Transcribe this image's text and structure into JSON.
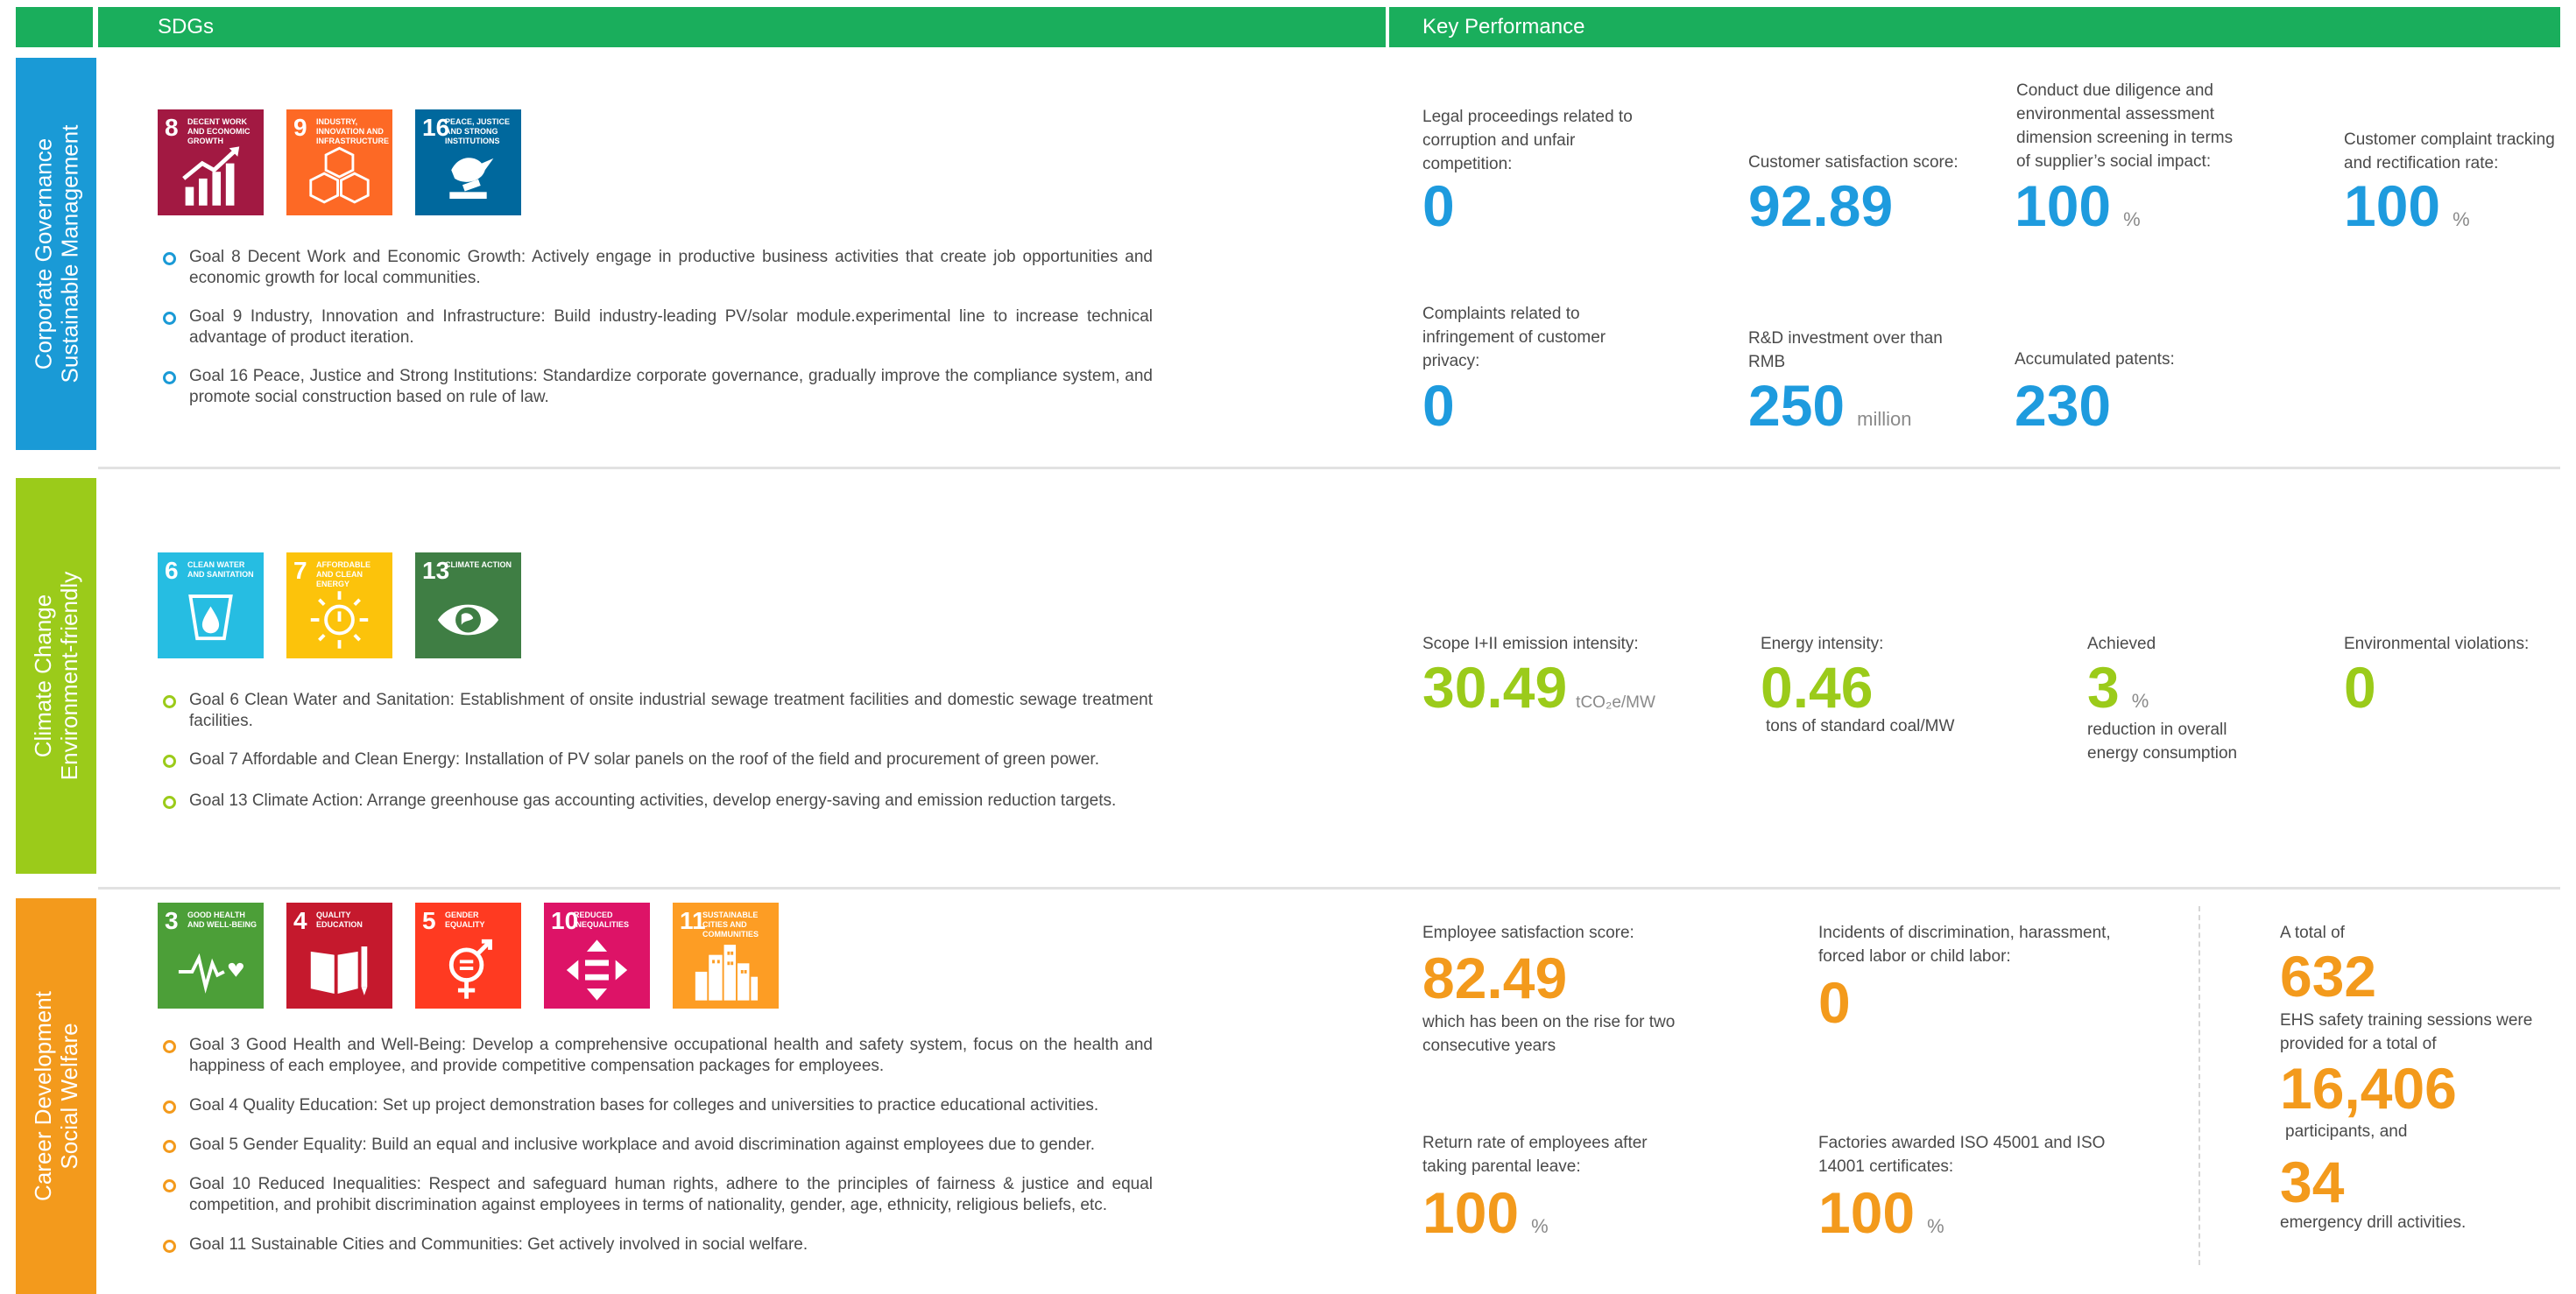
{
  "header": {
    "sdgs": "SDGs",
    "key_performance": "Key Performance"
  },
  "colors": {
    "green_header": "#1aae5c",
    "section1": "#1a9ad6",
    "section2": "#9bcb1a",
    "section3": "#f39a1c"
  },
  "sections": [
    {
      "title_lines": [
        "Corporate Governance",
        "Sustainable Management"
      ],
      "icons": [
        {
          "num": "8",
          "caption": "DECENT WORK AND ECONOMIC GROWTH",
          "color": "#a21942",
          "icon": "growth-chart-icon"
        },
        {
          "num": "9",
          "caption": "INDUSTRY, INNOVATION AND INFRASTRUCTURE",
          "color": "#fd6925",
          "icon": "cubes-icon"
        },
        {
          "num": "16",
          "caption": "PEACE, JUSTICE AND STRONG INSTITUTIONS",
          "color": "#00689d",
          "icon": "dove-gavel-icon"
        }
      ],
      "goals": [
        "Goal 8 Decent Work and Economic Growth: Actively engage in productive business activities that create job opportunities and economic growth for local communities.",
        "Goal 9 Industry, Innovation and Infrastructure: Build industry-leading PV/solar module.experimental line to increase technical advantage of product iteration.",
        "Goal 16 Peace, Justice and Strong Institutions: Standardize corporate governance, gradually improve the compliance system, and promote social construction based on rule of law."
      ],
      "metrics": [
        {
          "label": "Legal proceedings related to corruption and unfair competition:",
          "value": "0",
          "unit": ""
        },
        {
          "label": "Customer satisfaction score:",
          "value": "92.89",
          "unit": ""
        },
        {
          "label": "Conduct due diligence and environmental assessment dimension screening in terms of supplier’s social impact:",
          "value": "100",
          "unit": "%"
        },
        {
          "label": "Customer complaint tracking and rectification rate:",
          "value": "100",
          "unit": "%"
        },
        {
          "label": "Complaints related to infringement of customer privacy:",
          "value": "0",
          "unit": ""
        },
        {
          "label": "R&D investment over than RMB",
          "value": "250",
          "unit": "million"
        },
        {
          "label": "Accumulated patents:",
          "value": "230",
          "unit": ""
        }
      ]
    },
    {
      "title_lines": [
        "Climate Change",
        "Environment-friendly"
      ],
      "icons": [
        {
          "num": "6",
          "caption": "CLEAN WATER AND SANITATION",
          "color": "#26bde2",
          "icon": "water-drop-icon"
        },
        {
          "num": "7",
          "caption": "AFFORDABLE AND CLEAN ENERGY",
          "color": "#fcc30b",
          "icon": "sun-power-icon"
        },
        {
          "num": "13",
          "caption": "CLIMATE ACTION",
          "color": "#3f7e44",
          "icon": "eye-globe-icon"
        }
      ],
      "goals": [
        "Goal 6 Clean Water and Sanitation: Establishment of onsite industrial sewage treatment facilities and domestic sewage treatment facilities.",
        "Goal 7 Affordable and Clean Energy: Installation of PV solar panels on the roof of the field and procurement of green power.",
        "Goal 13 Climate Action: Arrange greenhouse gas accounting activities, develop energy-saving and emission reduction targets."
      ],
      "metrics": [
        {
          "label": "Scope I+II emission intensity:",
          "value": "30.49",
          "unit": "tCO₂e/MW"
        },
        {
          "label": "Energy intensity:",
          "value": "0.46",
          "sub": "tons of standard coal/MW"
        },
        {
          "label": "Achieved",
          "value": "3",
          "unit": "%",
          "sub": "reduction in overall energy consumption"
        },
        {
          "label": "Environmental violations:",
          "value": "0"
        }
      ]
    },
    {
      "title_lines": [
        "Career Development",
        "Social Welfare"
      ],
      "icons": [
        {
          "num": "3",
          "caption": "GOOD HEALTH AND WELL-BEING",
          "color": "#4c9f38",
          "icon": "heartbeat-icon"
        },
        {
          "num": "4",
          "caption": "QUALITY EDUCATION",
          "color": "#c5192d",
          "icon": "book-pencil-icon"
        },
        {
          "num": "5",
          "caption": "GENDER EQUALITY",
          "color": "#ff3a21",
          "icon": "gender-equality-icon"
        },
        {
          "num": "10",
          "caption": "REDUCED INEQUALITIES",
          "color": "#dd1367",
          "icon": "equality-arrows-icon"
        },
        {
          "num": "11",
          "caption": "SUSTAINABLE CITIES AND COMMUNITIES",
          "color": "#fd9d24",
          "icon": "city-buildings-icon"
        }
      ],
      "goals": [
        "Goal 3 Good Health and Well-Being: Develop a comprehensive occupational health and safety system, focus on the health and happiness of each employee, and provide competitive compensation packages for employees.",
        "Goal 4 Quality Education: Set up project demonstration bases for colleges and universities to practice educational activities.",
        "Goal 5 Gender Equality: Build an equal and inclusive workplace and avoid discrimination against employees due to gender.",
        "Goal 10 Reduced Inequalities: Respect and safeguard human rights, adhere to the principles of fairness & justice and equal competition, and prohibit discrimination against employees in terms of nationality, gender, age, ethnicity, religious beliefs, etc.",
        "Goal 11 Sustainable Cities and Communities: Get actively involved in social welfare."
      ],
      "metrics": [
        {
          "label": "Employee satisfaction score:",
          "value": "82.49",
          "sub": "which has been on the rise for two consecutive years"
        },
        {
          "label": "Incidents of discrimination, harassment, forced labor or child labor:",
          "value": "0"
        },
        {
          "label": "Return rate of employees after taking parental leave:",
          "value": "100",
          "unit": "%"
        },
        {
          "label": "Factories awarded ISO 45001 and ISO 14001 certificates:",
          "value": "100",
          "unit": "%"
        },
        {
          "label": "A total of",
          "value": "632",
          "sub": "EHS safety training sessions were provided for a total of",
          "value2": "16,406",
          "sub2": "participants, and",
          "value3": "34",
          "sub3": "emergency drill activities."
        }
      ]
    }
  ]
}
